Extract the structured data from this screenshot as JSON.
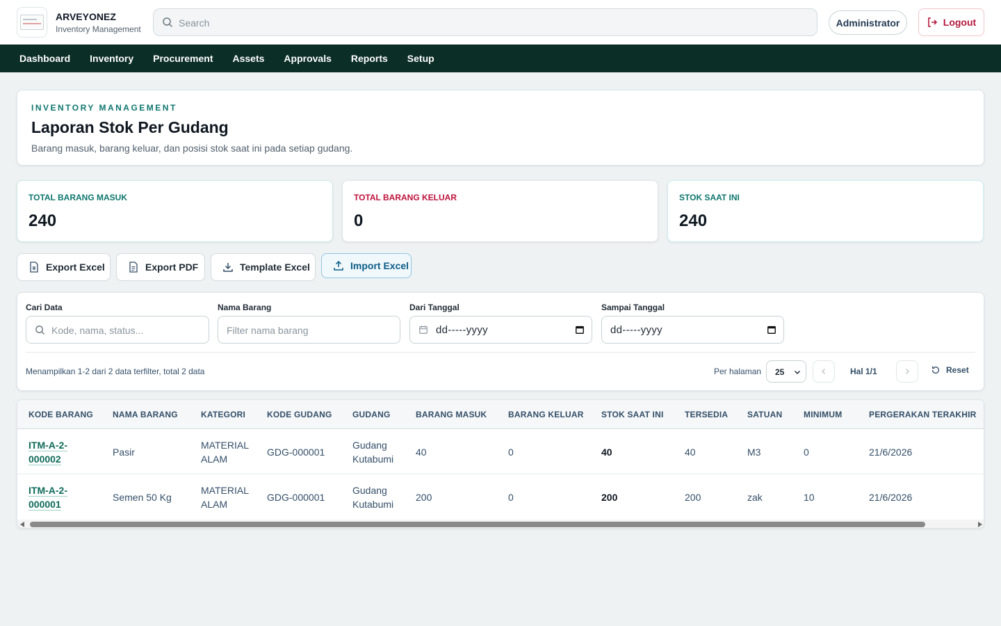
{
  "header": {
    "brand_name": "ARVEYONEZ",
    "brand_sub": "Inventory Management",
    "search_placeholder": "Search",
    "user_label": "Administrator",
    "logout_label": "Logout"
  },
  "nav": {
    "items": [
      "Dashboard",
      "Inventory",
      "Procurement",
      "Assets",
      "Approvals",
      "Reports",
      "Setup"
    ]
  },
  "page": {
    "eyebrow": "INVENTORY MANAGEMENT",
    "title": "Laporan Stok Per Gudang",
    "description": "Barang masuk, barang keluar, dan posisi stok saat ini pada setiap gudang."
  },
  "stats": [
    {
      "label": "TOTAL BARANG MASUK",
      "value": "240",
      "color": "#0f766e"
    },
    {
      "label": "TOTAL BARANG KELUAR",
      "value": "0",
      "color": "#be123c"
    },
    {
      "label": "STOK SAAT INI",
      "value": "240",
      "color": "#0f766e"
    }
  ],
  "actions": {
    "export_excel": "Export Excel",
    "export_pdf": "Export PDF",
    "template_excel": "Template Excel",
    "import_excel": "Import Excel"
  },
  "filters": {
    "search_label": "Cari Data",
    "search_placeholder": "Kode, nama, status...",
    "name_label": "Nama Barang",
    "name_placeholder": "Filter nama barang",
    "from_label": "Dari Tanggal",
    "from_value": "dd-----yyyy",
    "to_label": "Sampai Tanggal",
    "to_value": "dd-----yyyy",
    "summary": "Menampilkan 1-2 dari 2 data terfilter, total 2 data",
    "per_page_label": "Per halaman",
    "per_page_value": "25",
    "page_info": "Hal 1/1",
    "reset_label": "Reset"
  },
  "table": {
    "columns": [
      "KODE BARANG",
      "NAMA BARANG",
      "KATEGORI",
      "KODE GUDANG",
      "GUDANG",
      "BARANG MASUK",
      "BARANG KELUAR",
      "STOK SAAT INI",
      "TERSEDIA",
      "SATUAN",
      "MINIMUM",
      "PERGERAKAN TERAKHIR"
    ],
    "rows": [
      {
        "kode": "ITM-A-2-000002",
        "nama": "Pasir",
        "kategori": "MATERIAL ALAM",
        "kode_gudang": "GDG-000001",
        "gudang": "Gudang Kutabumi",
        "masuk": "40",
        "keluar": "0",
        "stok": "40",
        "tersedia": "40",
        "satuan": "M3",
        "minimum": "0",
        "terakhir": "21/6/2026"
      },
      {
        "kode": "ITM-A-2-000001",
        "nama": "Semen 50 Kg",
        "kategori": "MATERIAL ALAM",
        "kode_gudang": "GDG-000001",
        "gudang": "Gudang Kutabumi",
        "masuk": "200",
        "keluar": "0",
        "stok": "200",
        "tersedia": "200",
        "satuan": "zak",
        "minimum": "10",
        "terakhir": "21/6/2026"
      }
    ]
  },
  "colors": {
    "nav_bg": "#0b2e26",
    "accent": "#0f766e",
    "danger": "#be123c"
  }
}
